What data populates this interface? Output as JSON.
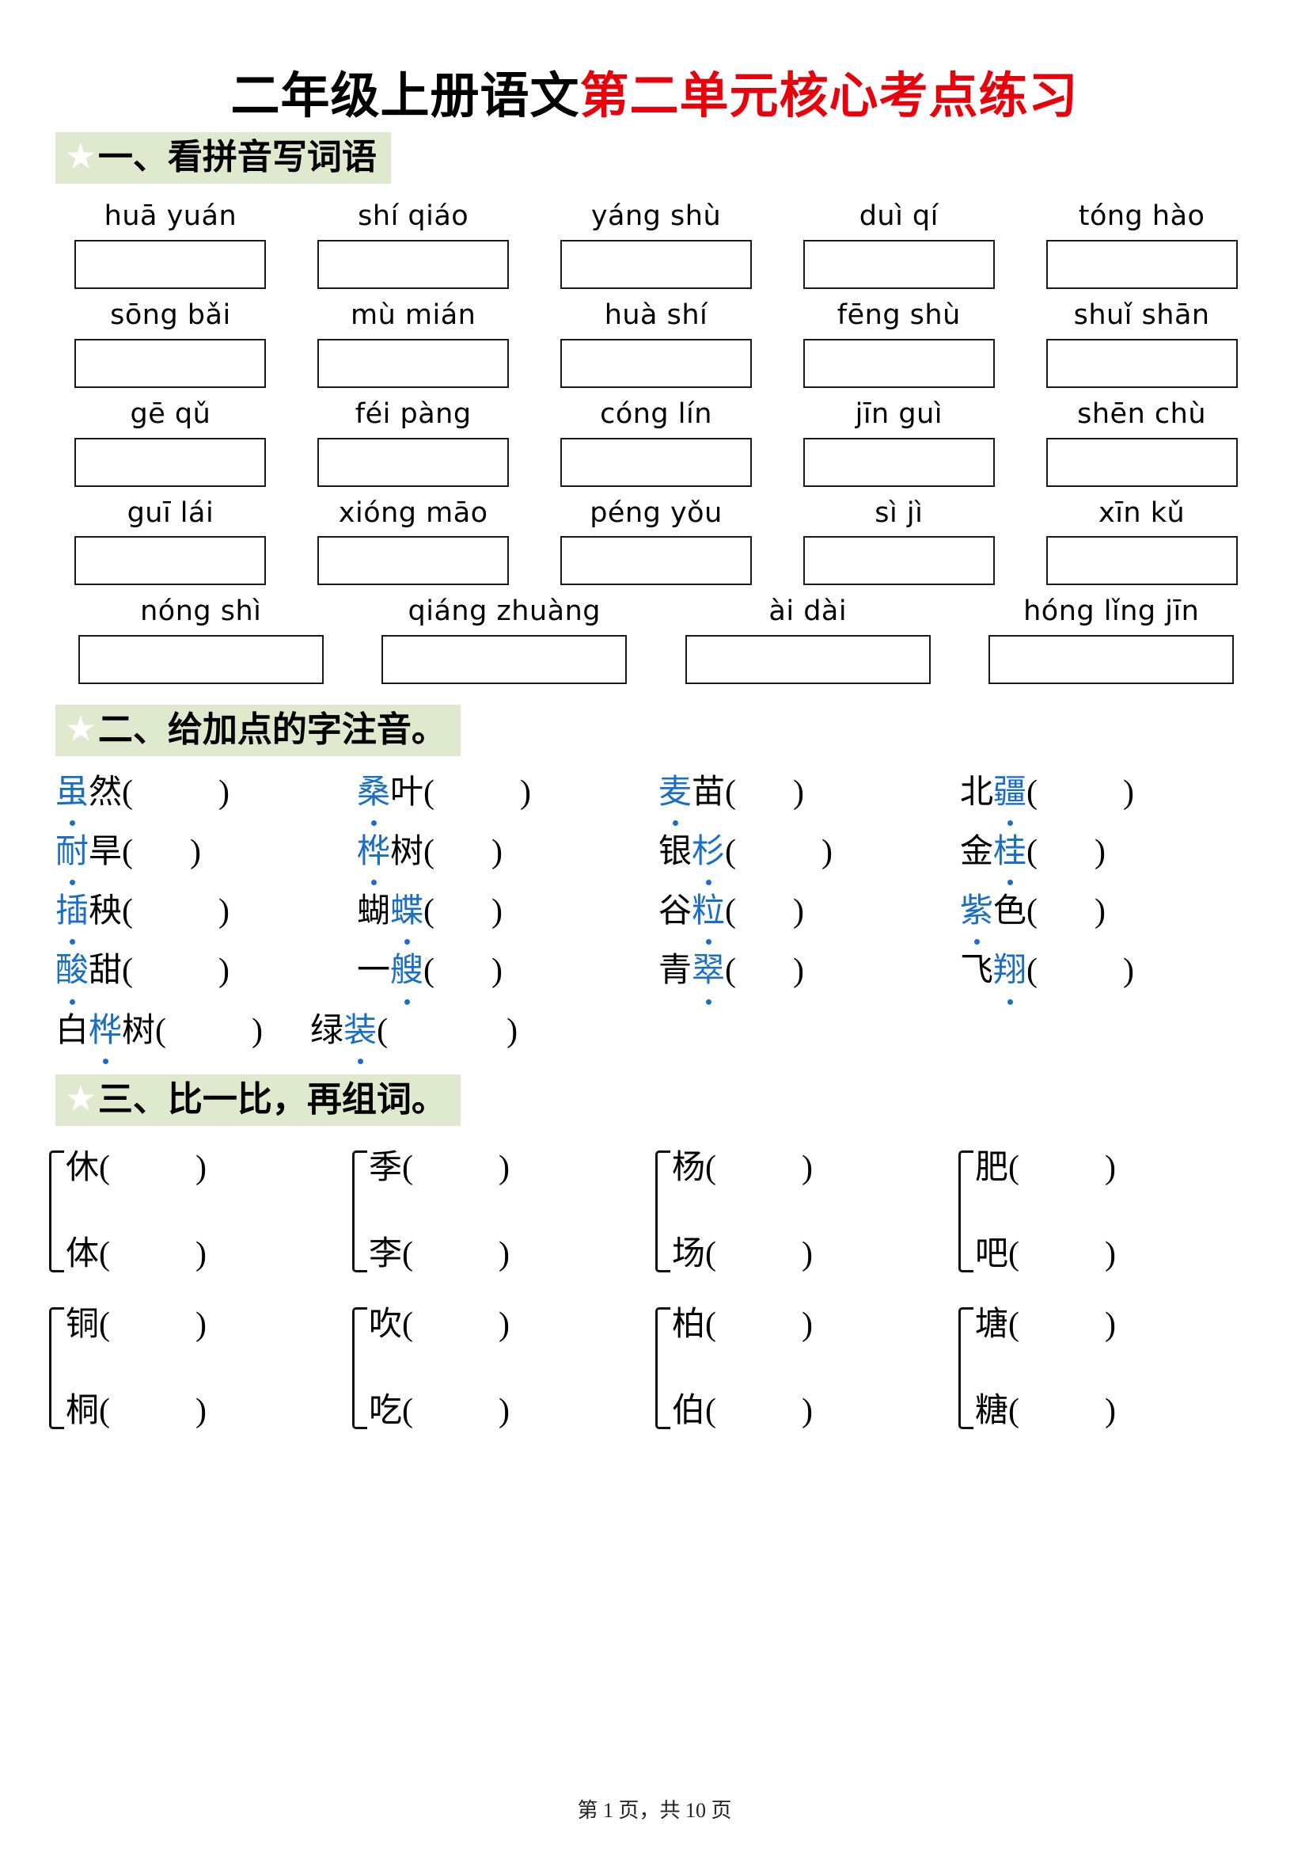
{
  "title": {
    "black_part": "二年级上册语文",
    "red_part": "第二单元核心考点练习",
    "red_color": "#e8000b"
  },
  "sections": [
    {
      "id": "section-one",
      "star": "★",
      "heading": "一、看拼音写词语",
      "type": "pinyin-to-word",
      "rows": [
        {
          "items": [
            "huā yuán",
            "shí qiáo",
            "yáng shù",
            "duì qí",
            "tóng hào"
          ]
        },
        {
          "items": [
            "sōng bǎi",
            "mù mián",
            "huà shí",
            "fēng shù",
            "shuǐ shān"
          ]
        },
        {
          "items": [
            "gē qǔ",
            "féi pàng",
            "cóng lín",
            "jīn guì",
            "shēn chù"
          ]
        },
        {
          "items": [
            "guī lái",
            "xióng māo",
            "péng yǒu",
            "sì jì",
            "xīn kǔ"
          ]
        },
        {
          "items": [
            "nóng shì",
            "qiáng zhuàng",
            "ài dài",
            "hóng lǐng jīn"
          ]
        }
      ]
    },
    {
      "id": "section-two",
      "star": "★",
      "heading": "二、给加点的字注音。",
      "type": "annotate-pinyin",
      "dot_color": "#1a6fc4",
      "rows": [
        [
          {
            "pre": "",
            "dot": "虽",
            "post": "然",
            "gap": "gap-m"
          },
          {
            "pre": "",
            "dot": "桑",
            "post": "叶",
            "gap": "gap-m"
          },
          {
            "pre": "",
            "dot": "麦",
            "post": "苗",
            "gap": "gap-s"
          },
          {
            "pre": "北",
            "dot": "疆",
            "post": "",
            "gap": "gap-m"
          }
        ],
        [
          {
            "pre": "",
            "dot": "耐",
            "post": "旱",
            "gap": "gap-s"
          },
          {
            "pre": "",
            "dot": "桦",
            "post": "树",
            "gap": "gap-s"
          },
          {
            "pre": "银",
            "dot": "杉",
            "post": "",
            "gap": "gap-m"
          },
          {
            "pre": "金",
            "dot": "桂",
            "post": "",
            "gap": "gap-s"
          }
        ],
        [
          {
            "pre": "",
            "dot": "插",
            "post": "秧",
            "gap": "gap-m"
          },
          {
            "pre": "蝴",
            "dot": "蝶",
            "post": "",
            "gap": "gap-s"
          },
          {
            "pre": "谷",
            "dot": "粒",
            "post": "",
            "gap": "gap-s"
          },
          {
            "pre": "",
            "dot": "紫",
            "post": "色",
            "gap": "gap-s"
          }
        ],
        [
          {
            "pre": "",
            "dot": "酸",
            "post": "甜",
            "gap": "gap-m"
          },
          {
            "pre": "一",
            "dot": "艘",
            "post": "",
            "gap": "gap-s"
          },
          {
            "pre": "青",
            "dot": "翠",
            "post": "",
            "gap": "gap-s"
          },
          {
            "pre": "飞",
            "dot": "翔",
            "post": "",
            "gap": "gap-m"
          }
        ],
        [
          {
            "pre": "白",
            "dot": "桦",
            "post": "树",
            "gap": "gap-m"
          },
          {
            "pre": "绿",
            "dot": "装",
            "post": "",
            "gap": "gap-l"
          }
        ]
      ]
    },
    {
      "id": "section-three",
      "star": "★",
      "heading": "三、比一比，再组词。",
      "type": "compare-and-compose",
      "rows": [
        [
          {
            "top": "休",
            "bottom": "体"
          },
          {
            "top": "季",
            "bottom": "李"
          },
          {
            "top": "杨",
            "bottom": "场"
          },
          {
            "top": "肥",
            "bottom": "吧"
          }
        ],
        [
          {
            "top": "铜",
            "bottom": "桐"
          },
          {
            "top": "吹",
            "bottom": "吃"
          },
          {
            "top": "柏",
            "bottom": "伯"
          },
          {
            "top": "塘",
            "bottom": "糖"
          }
        ]
      ]
    }
  ],
  "footer": {
    "text": "第 1 页，共 10 页"
  }
}
